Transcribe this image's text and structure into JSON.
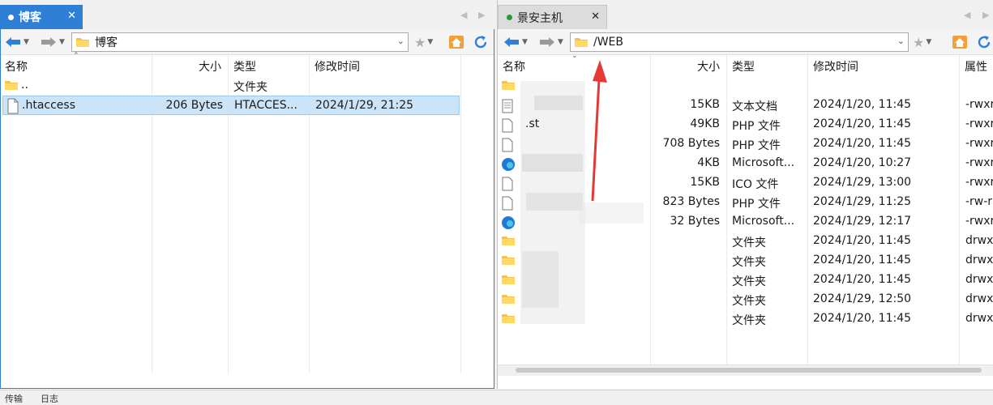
{
  "left": {
    "tab_label": "博客",
    "path": "博客",
    "columns": {
      "name": "名称",
      "size": "大小",
      "type": "类型",
      "modified": "修改时间"
    },
    "rows": [
      {
        "name": "..",
        "size": "",
        "type": "文件夹",
        "modified": ""
      },
      {
        "name": ".htaccess",
        "size": "206 Bytes",
        "type": "HTACCES...",
        "modified": "2024/1/29, 21:25"
      }
    ]
  },
  "right": {
    "tab_label": "景安主机",
    "path": "/WEB",
    "columns": {
      "name": "名称",
      "size": "大小",
      "type": "类型",
      "modified": "修改时间",
      "perms": "属性"
    },
    "rows": [
      {
        "name": "",
        "size": "",
        "type": "",
        "modified": "",
        "perms": "",
        "icon": "folder"
      },
      {
        "name": "",
        "size": "15KB",
        "type": "文本文档",
        "modified": "2024/1/20, 11:45",
        "perms": "-rwxr",
        "icon": "text-file"
      },
      {
        "name": ".st",
        "size": "49KB",
        "type": "PHP 文件",
        "modified": "2024/1/20, 11:45",
        "perms": "-rwxr",
        "icon": "file"
      },
      {
        "name": "",
        "size": "708 Bytes",
        "type": "PHP 文件",
        "modified": "2024/1/20, 11:45",
        "perms": "-rwxr",
        "icon": "file"
      },
      {
        "name": "",
        "size": "4KB",
        "type": "Microsoft...",
        "modified": "2024/1/20, 10:27",
        "perms": "-rwxr",
        "icon": "edge"
      },
      {
        "name": "",
        "size": "15KB",
        "type": "ICO 文件",
        "modified": "2024/1/29, 13:00",
        "perms": "-rwxr",
        "icon": "file"
      },
      {
        "name": "",
        "size": "823 Bytes",
        "type": "PHP 文件",
        "modified": "2024/1/29, 11:25",
        "perms": "-rw-r",
        "icon": "file"
      },
      {
        "name": "",
        "size": "32 Bytes",
        "type": "Microsoft...",
        "modified": "2024/1/29, 12:17",
        "perms": "-rwxr",
        "icon": "edge"
      },
      {
        "name": "",
        "size": "",
        "type": "文件夹",
        "modified": "2024/1/20, 11:45",
        "perms": "drwx",
        "icon": "folder"
      },
      {
        "name": "",
        "size": "",
        "type": "文件夹",
        "modified": "2024/1/20, 11:45",
        "perms": "drwx",
        "icon": "folder"
      },
      {
        "name": "",
        "size": "",
        "type": "文件夹",
        "modified": "2024/1/20, 11:45",
        "perms": "drwx",
        "icon": "folder"
      },
      {
        "name": "",
        "size": "",
        "type": "文件夹",
        "modified": "2024/1/29, 12:50",
        "perms": "drwx",
        "icon": "folder"
      },
      {
        "name": "",
        "size": "",
        "type": "文件夹",
        "modified": "2024/1/20, 11:45",
        "perms": "drwx",
        "icon": "folder"
      }
    ]
  },
  "bottom_tabs": [
    "传输",
    "日志"
  ],
  "colors": {
    "accent": "#2f7fd6",
    "selection": "#cce4f7",
    "annotation_arrow": "#e53935"
  }
}
